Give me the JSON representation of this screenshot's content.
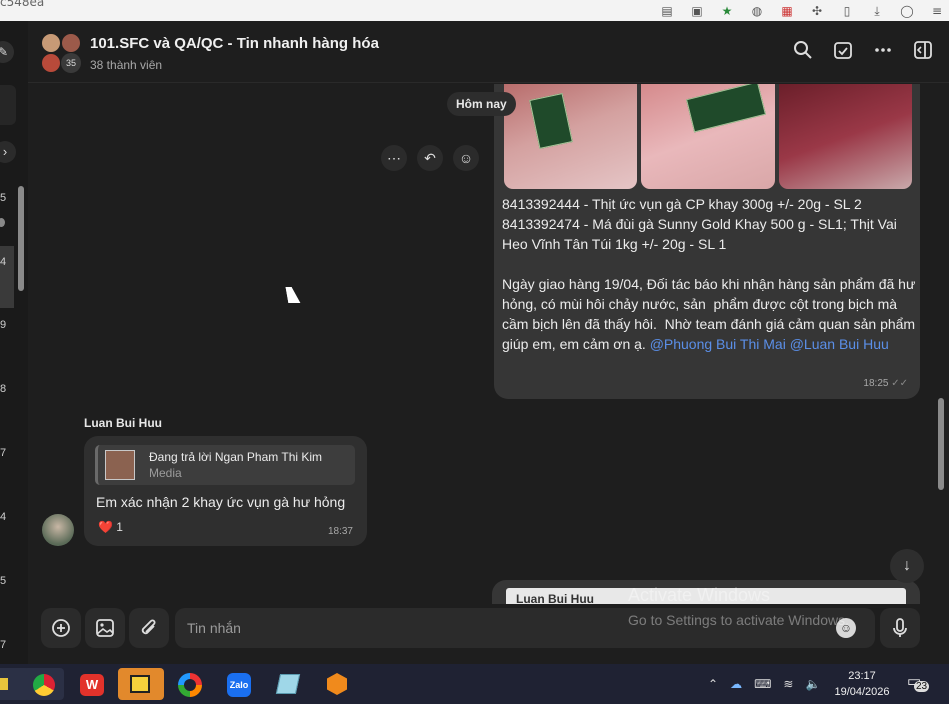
{
  "browser": {
    "url_fragment": "c548ea",
    "icon_names": [
      "translate-icon",
      "screenshot-icon",
      "star-icon",
      "shield-icon",
      "app-icon",
      "extensions-icon",
      "split-icon",
      "download-icon",
      "profile-icon",
      "menu-icon"
    ]
  },
  "rail": {
    "counts": [
      "5",
      "4",
      "9",
      "8",
      "7",
      "4",
      "5",
      "7"
    ]
  },
  "header": {
    "title": "101.SFC và QA/QC - Tin nhanh hàng hóa",
    "members": "38 thành viên",
    "avatar_overflow": "35",
    "icons": [
      "search-icon",
      "calendar-check-icon",
      "more-icon",
      "sidebar-toggle-icon"
    ]
  },
  "chat": {
    "date_separator": "Hôm nay",
    "outgoing": {
      "lines": [
        "8413392444 - Thịt ức vụn gà CP khay 300g +/- 20g - SL 2",
        "8413392474 - Má đùi gà Sunny Gold Khay 500 g - SL1; Thịt Vai Heo Vĩnh Tân Túi 1kg +/- 20g - SL 1",
        "",
        "Ngày giao hàng 19/04, Đối tác báo khi nhận hàng sản phẩm đã hư hỏng, có mùi hôi chảy nước, sản  phẩm được cột trong bịch mà cầm bịch lên đã thấy hôi.  Nhờ team đánh giá cảm quan sản phẩm giúp em, em cảm ơn ạ. "
      ],
      "mention_1": "@Phuong Bui Thi Mai",
      "mention_2": "@Luan Bui Huu",
      "time": "18:25"
    },
    "incoming": {
      "sender": "Luan Bui Huu",
      "reply_to": "Đang trả lời Ngan Pham Thi Kim",
      "reply_type": "Media",
      "text": "Em xác nhận 2 khay ức vụn gà hư hỏng",
      "reaction": "❤️",
      "reaction_count": "1",
      "time": "18:37"
    },
    "peek_sender": "Luan Bui Huu"
  },
  "composer": {
    "placeholder": "Tin nhắn"
  },
  "watermark": {
    "line1": "Activate Windows",
    "line2": "Go to Settings to activate Windows."
  },
  "taskbar": {
    "time": "23:17",
    "date": "19/04/2026",
    "notifications": "23",
    "apps": [
      "chrome-icon",
      "wps-icon",
      "sticky-notes-icon",
      "browser-icon",
      "zalo-icon",
      "notepad-icon",
      "sublime-icon"
    ]
  }
}
